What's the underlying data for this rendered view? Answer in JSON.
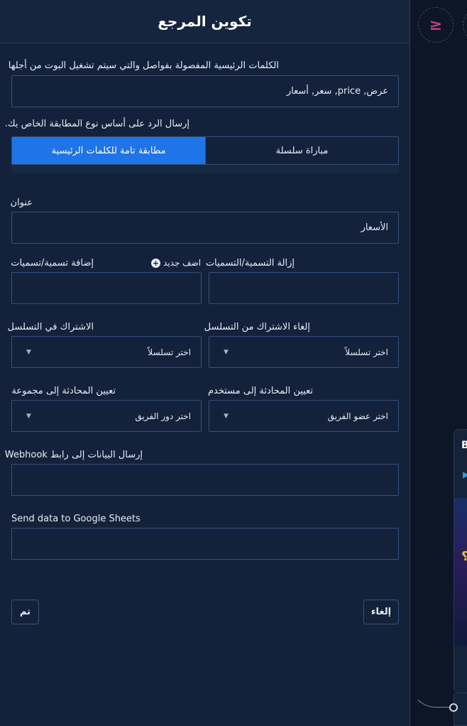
{
  "panel": {
    "title": "تكوين المرجع"
  },
  "keywords": {
    "label": "الكلمات الرئيسية المفصولة بفواصل والتي سيتم تشغيل البوت من أجلها",
    "value": "عرض, price, سعر, أسعار"
  },
  "match": {
    "label": "إرسال الرد على أساس نوع المطابقة الخاص بك.",
    "exact": "مطابقة تامة للكلمات الرئيسية",
    "string": "مباراة سلسلة"
  },
  "title_field": {
    "label": "عنوان",
    "value": "الأسعار"
  },
  "tags": {
    "add_label": "إضافة تسمية/تسميات",
    "add_new": "اضف جديد",
    "remove_label": "إزالة التسمية/التسميات"
  },
  "sequence": {
    "subscribe_label": "الاشتراك في التسلسل",
    "unsubscribe_label": "إلغاء الاشتراك من التسلسل",
    "placeholder": "اختر تسلسلاً"
  },
  "assign": {
    "group_label": "تعيين المحادثة إلى مجموعة",
    "group_placeholder": "اختر دور الفريق",
    "user_label": "تعيين المحادثة إلى مستخدم",
    "user_placeholder": "اختر عضو الفريق"
  },
  "webhook": {
    "label": "إرسال البيانات إلى رابط Webhook"
  },
  "sheets": {
    "label": "Send data to Google Sheets"
  },
  "buttons": {
    "done": "تم",
    "cancel": "إلغاء"
  },
  "canvas": {
    "node_symbol": "≥",
    "card_letter": "B",
    "card_symbol": "؟"
  }
}
